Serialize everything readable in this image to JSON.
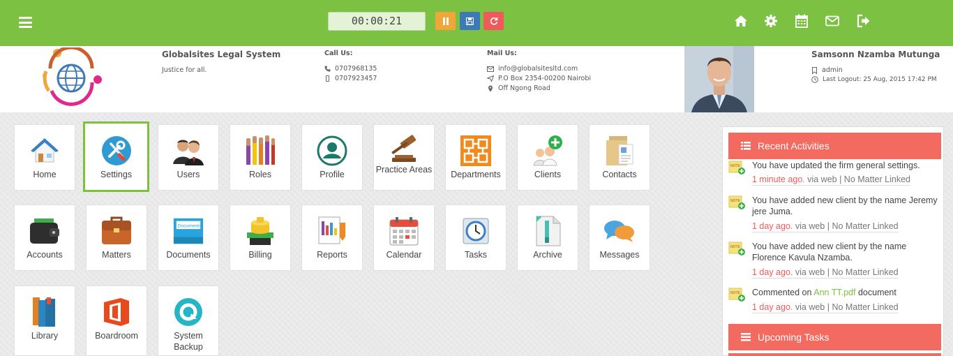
{
  "timer": {
    "value": "00:00:21"
  },
  "firm": {
    "name": "Globalsites Legal System",
    "tagline": "Justice for all.",
    "call_label": "Call Us:",
    "phone1": "0707968135",
    "phone2": "0707923457",
    "mail_label": "Mail Us:",
    "email": "info@globalsitesltd.com",
    "box": "P.O Box 2354-00200 Nairobi",
    "road": "Off Ngong Road"
  },
  "user": {
    "name": "Samsonn Nzamba Mutunga",
    "role": "admin",
    "last_logout": "Last Logout: 25 Aug, 2015 17:42 PM"
  },
  "tiles": {
    "home": "Home",
    "settings": "Settings",
    "users": "Users",
    "roles": "Roles",
    "profile": "Profile",
    "practice_areas": "Practice Areas",
    "departments": "Departments",
    "clients": "Clients",
    "contacts": "Contacts",
    "accounts": "Accounts",
    "matters": "Matters",
    "documents": "Documents",
    "billing": "Billing",
    "reports": "Reports",
    "calendar": "Calendar",
    "tasks": "Tasks",
    "archive": "Archive",
    "messages": "Messages",
    "library": "Library",
    "boardroom": "Boardroom",
    "system_backup": "System Backup"
  },
  "recent": {
    "title": "Recent Activities",
    "items": [
      {
        "text": "You have updated the firm general settings.",
        "time": "1 minute ago.",
        "meta": " via web | No Matter Linked"
      },
      {
        "text": "You have added new client by the name Jeremy jere Juma.",
        "time": "1 day ago.",
        "meta": " via web | No Matter Linked"
      },
      {
        "text": "You have added new client by the name Florence Kavula Nzamba.",
        "time": "1 day ago.",
        "meta": " via web | No Matter Linked"
      },
      {
        "text_pre": "Commented on ",
        "text_link": "Ann TT.pdf",
        "text_post": " document",
        "time": "1 day ago.",
        "meta": " via web | No Matter Linked"
      }
    ]
  },
  "upcoming": {
    "title": "Upcoming Tasks"
  },
  "colors": {
    "brand_green": "#7cc142",
    "accent_red": "#f26a60",
    "pause_orange": "#f1a63a",
    "save_blue": "#3c79b8"
  }
}
